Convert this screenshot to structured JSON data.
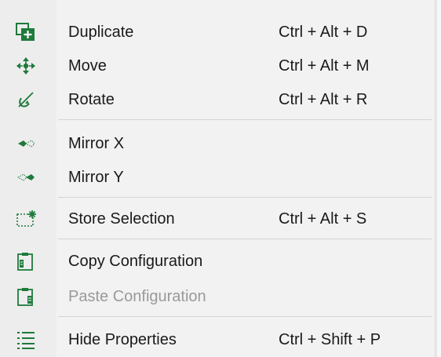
{
  "menu": {
    "items": [
      {
        "label": "Duplicate",
        "shortcut": "Ctrl + Alt + D",
        "icon": "duplicate-icon",
        "enabled": true
      },
      {
        "label": "Move",
        "shortcut": "Ctrl + Alt + M",
        "icon": "move-icon",
        "enabled": true
      },
      {
        "label": "Rotate",
        "shortcut": "Ctrl + Alt + R",
        "icon": "rotate-icon",
        "enabled": true
      },
      {
        "label": "Mirror X",
        "shortcut": "",
        "icon": "mirror-x-icon",
        "enabled": true
      },
      {
        "label": "Mirror Y",
        "shortcut": "",
        "icon": "mirror-y-icon",
        "enabled": true
      },
      {
        "label": "Store Selection",
        "shortcut": "Ctrl + Alt + S",
        "icon": "store-selection-icon",
        "enabled": true
      },
      {
        "label": "Copy Configuration",
        "shortcut": "",
        "icon": "copy-configuration-icon",
        "enabled": true
      },
      {
        "label": "Paste Configuration",
        "shortcut": "",
        "icon": "paste-configuration-icon",
        "enabled": false
      },
      {
        "label": "Hide Properties",
        "shortcut": "Ctrl + Shift + P",
        "icon": "hide-properties-icon",
        "enabled": true
      }
    ]
  },
  "colors": {
    "accent_green": "#1e7a3c",
    "text": "#1a1a1a",
    "disabled_text": "#9a9a9a",
    "separator": "#d4d4d4",
    "background": "#f2f2f2"
  }
}
